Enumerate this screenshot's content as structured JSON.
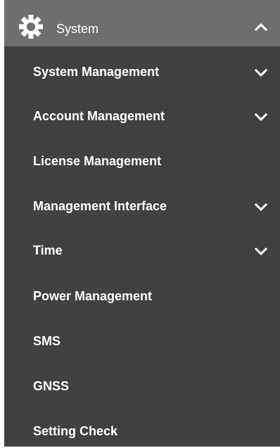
{
  "menu": {
    "header": {
      "label": "System",
      "icon": "gear-icon",
      "expanded": true
    },
    "items": [
      {
        "label": "System Management",
        "has_submenu": true,
        "expanded": false
      },
      {
        "label": "Account Management",
        "has_submenu": true,
        "expanded": false
      },
      {
        "label": "License Management",
        "has_submenu": false
      },
      {
        "label": "Management Interface",
        "has_submenu": true,
        "expanded": false
      },
      {
        "label": "Time",
        "has_submenu": true,
        "expanded": false
      },
      {
        "label": "Power Management",
        "has_submenu": false
      },
      {
        "label": "SMS",
        "has_submenu": false
      },
      {
        "label": "GNSS",
        "has_submenu": false
      },
      {
        "label": "Setting Check",
        "has_submenu": false
      }
    ]
  },
  "colors": {
    "menu_background": "#414141",
    "header_background": "#6f6f6f",
    "text": "#ffffff"
  }
}
